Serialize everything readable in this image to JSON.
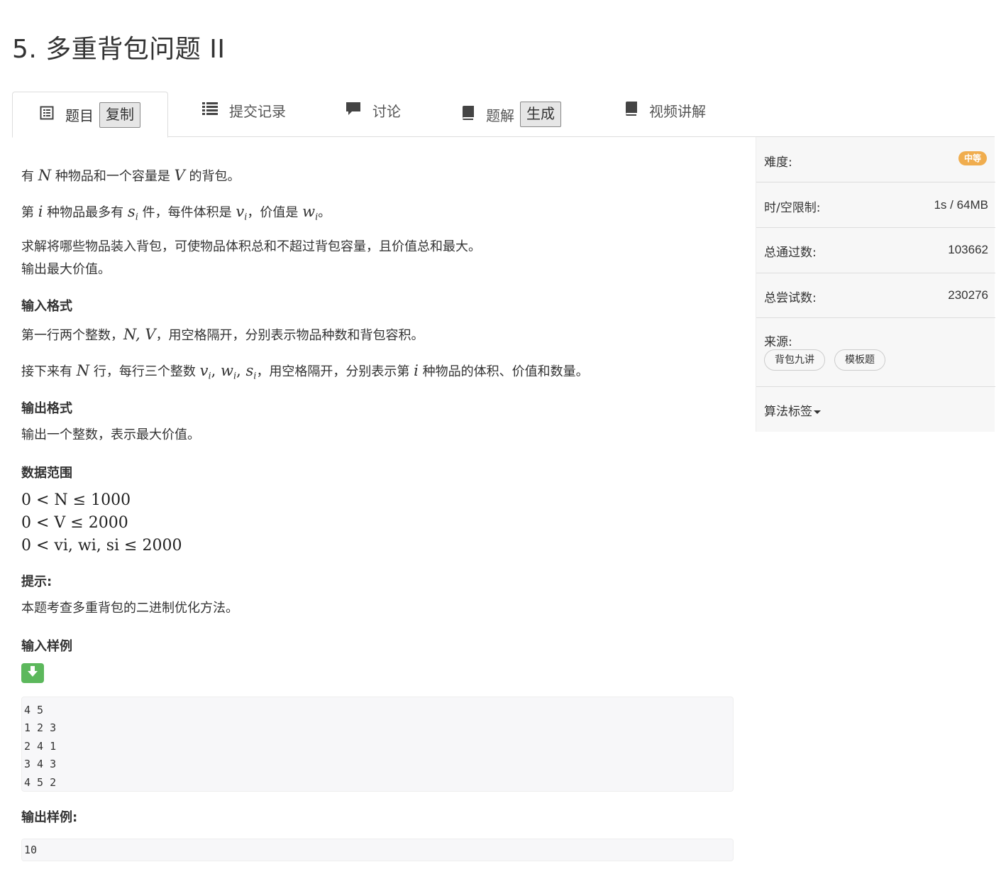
{
  "problem": {
    "title": "5. 多重背包问题 II"
  },
  "tabs": {
    "statement": {
      "label": "题目",
      "action": "复制",
      "icon": "file-text-icon"
    },
    "submissions": {
      "label": "提交记录",
      "icon": "list-icon"
    },
    "discussion": {
      "label": "讨论",
      "icon": "comment-icon"
    },
    "solution": {
      "label": "题解",
      "action": "生成",
      "icon": "book-icon"
    },
    "video": {
      "label": "视频讲解",
      "icon": "book-icon"
    }
  },
  "statement": {
    "p1": {
      "a": "有 ",
      "N": "N",
      "b": " 种物品和一个容量是 ",
      "V": "V",
      "c": " 的背包。"
    },
    "p2": {
      "a": "第 ",
      "i": "i",
      "b": " 种物品最多有 ",
      "s": "s",
      "si": "i",
      "c": " 件，每件体积是 ",
      "v": "v",
      "vi": "i",
      "d": "，价值是 ",
      "w": "w",
      "wi": "i",
      "e": "。"
    },
    "p3_line1": "求解将哪些物品装入背包，可使物品体积总和不超过背包容量，且价值总和最大。",
    "p3_line2": "输出最大价值。",
    "input_format_heading": "输入格式",
    "input_p1": {
      "a": "第一行两个整数，",
      "math": "N, V",
      "b": "，用空格隔开，分别表示物品种数和背包容积。"
    },
    "input_p2": {
      "a": "接下来有 ",
      "N": "N",
      "b": " 行，每行三个整数 ",
      "math": "v",
      "c": "，用空格隔开，分别表示第 ",
      "i": "i",
      "d": " 种物品的体积、价值和数量。"
    },
    "output_format_heading": "输出格式",
    "output_p": "输出一个整数，表示最大价值。",
    "range_heading": "数据范围",
    "range_line1": "0 < N ≤ 1000",
    "range_line2": "0 < V ≤ 2000",
    "range_line3": "0 < vi, wi, si ≤ 2000",
    "hint_heading": "提示:",
    "hint_text": "本题考查多重背包的二进制优化方法。",
    "sample_input_heading": "输入样例",
    "sample_input": "4 5\n1 2 3\n2 4 1\n3 4 3\n4 5 2",
    "sample_output_heading": "输出样例:",
    "sample_output": "10"
  },
  "sidebar": {
    "difficulty_label": "难度:",
    "difficulty_value": "中等",
    "limit_label": "时/空限制:",
    "limit_value": "1s / 64MB",
    "passed_label": "总通过数:",
    "passed_value": "103662",
    "attempts_label": "总尝试数:",
    "attempts_value": "230276",
    "source_label": "来源:",
    "source_tags": [
      "背包九讲",
      "模板题"
    ],
    "algo_tags_label": "算法标签"
  },
  "colors": {
    "difficulty_badge": "#f0ad4e",
    "download_button": "#5cb85c"
  }
}
